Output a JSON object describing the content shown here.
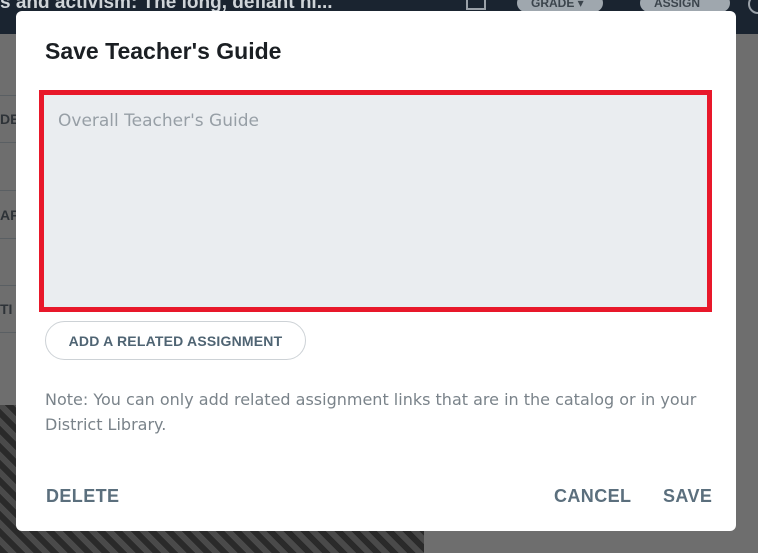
{
  "background": {
    "header_title": "s and activism: The long, defiant hi...",
    "grade_label": "GRADE ▾",
    "assign_label": "ASSIGN",
    "side_labels": [
      "DE",
      "AF",
      "TI"
    ]
  },
  "modal": {
    "title": "Save Teacher's Guide",
    "guide_placeholder": "Overall Teacher's Guide",
    "guide_value": "",
    "add_related_label": "ADD A RELATED ASSIGNMENT",
    "note": "Note: You can only add related assignment links that are in the catalog or in your District Library.",
    "delete_label": "DELETE",
    "cancel_label": "CANCEL",
    "save_label": "SAVE"
  },
  "colors": {
    "highlight_border": "#e8182a",
    "button_text": "#5b6f7d",
    "input_background": "#eaedf0"
  }
}
